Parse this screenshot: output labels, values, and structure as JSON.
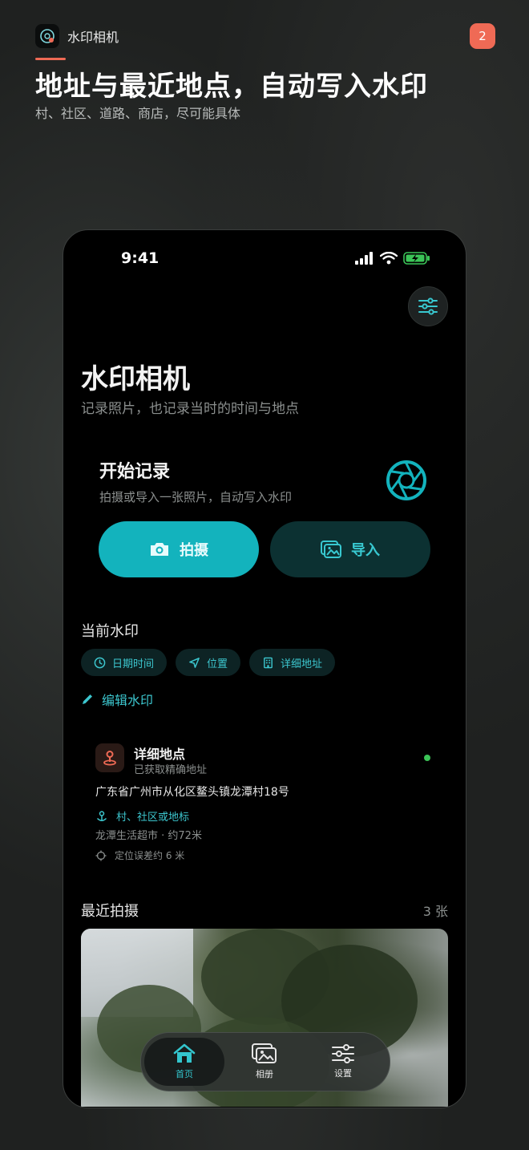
{
  "promo": {
    "app_name": "水印相机",
    "badge": "2",
    "headline": "地址与最近地点，自动写入水印",
    "subheadline": "村、社区、道路、商店，尽可能具体"
  },
  "status_bar": {
    "time": "9:41"
  },
  "header": {
    "title": "水印相机",
    "subtitle": "记录照片，也记录当时的时间与地点"
  },
  "start": {
    "title": "开始记录",
    "subtitle": "拍摄或导入一张照片，自动写入水印",
    "shoot_label": "拍摄",
    "import_label": "导入"
  },
  "watermark": {
    "section_title": "当前水印",
    "chips": [
      {
        "label": "日期时间",
        "icon": "clock-icon"
      },
      {
        "label": "位置",
        "icon": "navigation-arrow-icon"
      },
      {
        "label": "详细地址",
        "icon": "building-icon"
      }
    ],
    "edit_label": "编辑水印"
  },
  "location": {
    "title": "详细地点",
    "status": "已获取精确地址",
    "address": "广东省广州市从化区鳌头镇龙潭村18号",
    "landmark_label": "村、社区或地标",
    "nearby": "龙潭生活超市 · 约72米",
    "accuracy": "定位误差约 6 米",
    "status_color": "#3bc457"
  },
  "recent": {
    "title": "最近拍摄",
    "count": "3 张"
  },
  "tabbar": {
    "tabs": [
      {
        "label": "首页",
        "icon": "home-icon",
        "active": true
      },
      {
        "label": "相册",
        "icon": "photo-album-icon",
        "active": false
      },
      {
        "label": "设置",
        "icon": "sliders-icon",
        "active": false
      }
    ]
  },
  "colors": {
    "accent": "#13b3bd",
    "accent_text": "#3cc6ce",
    "badge": "#ef6a55",
    "background": "#000000"
  }
}
